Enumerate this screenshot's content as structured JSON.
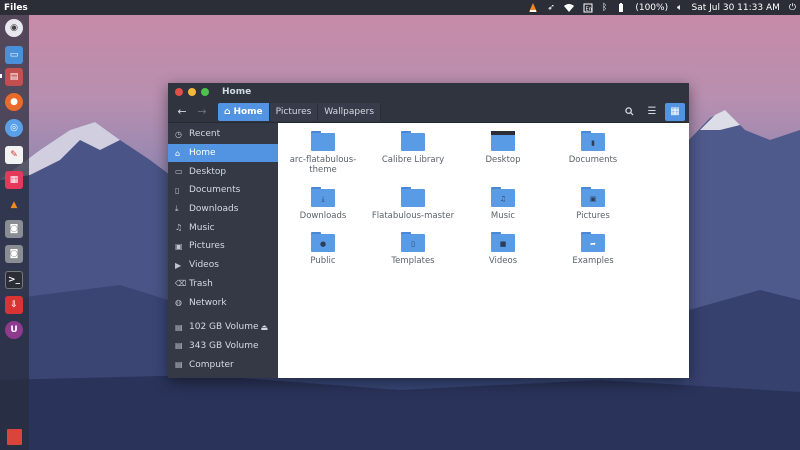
{
  "panel": {
    "app_name": "Files",
    "battery": "(100%)",
    "datetime": "Sat Jul 30 11:33 AM",
    "tray_icons": [
      "vlc-icon",
      "rocket-icon",
      "wifi-icon",
      "keyboard-icon",
      "bluetooth-icon",
      "battery-icon",
      "volume-icon",
      "power-icon"
    ]
  },
  "launcher": {
    "items": [
      "dash-icon",
      "desktop-icon",
      "files-icon",
      "firefox-icon",
      "chromium-icon",
      "text-editor-icon",
      "app-grid-icon",
      "vlc-icon",
      "disk-icon",
      "disk-icon",
      "terminal-icon",
      "archive-icon",
      "update-icon",
      "trash-icon"
    ]
  },
  "window": {
    "title": "Home",
    "breadcrumbs": [
      "Home",
      "Pictures",
      "Wallpapers"
    ],
    "sidebar": [
      {
        "label": "Recent",
        "icon": "clock-icon"
      },
      {
        "label": "Home",
        "icon": "home-icon",
        "active": true
      },
      {
        "label": "Desktop",
        "icon": "desktop-icon"
      },
      {
        "label": "Documents",
        "icon": "document-icon"
      },
      {
        "label": "Downloads",
        "icon": "download-icon"
      },
      {
        "label": "Music",
        "icon": "music-icon"
      },
      {
        "label": "Pictures",
        "icon": "picture-icon"
      },
      {
        "label": "Videos",
        "icon": "video-icon"
      },
      {
        "label": "Trash",
        "icon": "trash-icon"
      },
      {
        "label": "Network",
        "icon": "network-icon"
      },
      {
        "label": "102 GB Volume",
        "icon": "drive-icon"
      },
      {
        "label": "343 GB Volume",
        "icon": "drive-icon"
      },
      {
        "label": "Computer",
        "icon": "computer-icon"
      }
    ],
    "files": [
      {
        "name": "arc-flatabulous-theme",
        "icon": "folder-icon"
      },
      {
        "name": "Calibre Library",
        "icon": "folder-icon"
      },
      {
        "name": "Desktop",
        "icon": "desktop-folder-icon"
      },
      {
        "name": "Documents",
        "icon": "documents-folder-icon"
      },
      {
        "name": "Downloads",
        "icon": "downloads-folder-icon"
      },
      {
        "name": "Flatabulous-master",
        "icon": "folder-icon"
      },
      {
        "name": "Music",
        "icon": "music-folder-icon"
      },
      {
        "name": "Pictures",
        "icon": "pictures-folder-icon"
      },
      {
        "name": "Public",
        "icon": "public-folder-icon"
      },
      {
        "name": "Templates",
        "icon": "templates-folder-icon"
      },
      {
        "name": "Videos",
        "icon": "videos-folder-icon"
      },
      {
        "name": "Examples",
        "icon": "examples-folder-icon"
      }
    ]
  },
  "colors": {
    "accent": "#5294e2",
    "titlebar": "#2f343f",
    "sidebar": "#353945"
  }
}
